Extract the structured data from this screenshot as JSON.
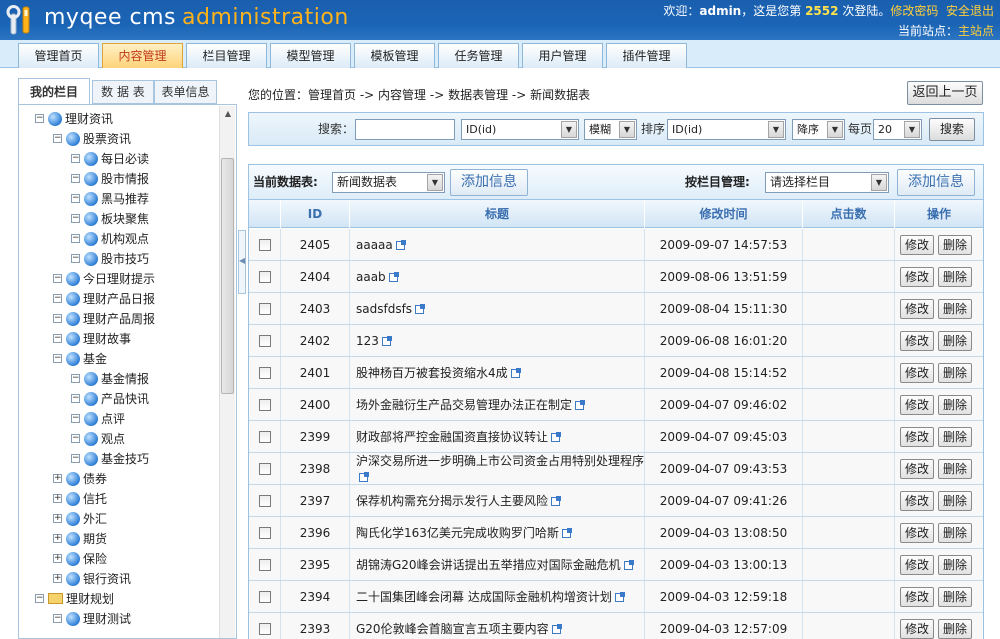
{
  "header": {
    "logo_main": "myqee cms",
    "logo_accent": "administration",
    "welcome_prefix": "欢迎：",
    "username": "admin",
    "welcome_mid": "，这是您第",
    "login_count": "2552",
    "welcome_suffix": "次登陆。",
    "change_password": "修改密码",
    "logout": "安全退出",
    "site_label": "当前站点：",
    "site_name": "主站点"
  },
  "nav": {
    "tabs": [
      {
        "label": "管理首页"
      },
      {
        "label": "内容管理"
      },
      {
        "label": "栏目管理"
      },
      {
        "label": "模型管理"
      },
      {
        "label": "模板管理"
      },
      {
        "label": "任务管理"
      },
      {
        "label": "用户管理"
      },
      {
        "label": "插件管理"
      }
    ],
    "active_color": "#c0391b"
  },
  "sidebar": {
    "tabs": [
      {
        "label": "我的栏目"
      },
      {
        "label": "数 据 表"
      },
      {
        "label": "表单信息"
      }
    ],
    "tree": [
      {
        "label": "理财资讯",
        "toggle": "⊟",
        "icon": "globe-icon"
      },
      {
        "label": "股票资讯",
        "toggle": "⊟",
        "icon": "globe-icon"
      },
      {
        "label": "每日必读",
        "toggle": "⊟",
        "icon": "globe-icon"
      },
      {
        "label": "股市情报",
        "toggle": "⊟",
        "icon": "globe-icon"
      },
      {
        "label": "黑马推荐",
        "toggle": "⊟",
        "icon": "globe-icon"
      },
      {
        "label": "板块聚焦",
        "toggle": "⊟",
        "icon": "globe-icon"
      },
      {
        "label": "机构观点",
        "toggle": "⊟",
        "icon": "globe-icon"
      },
      {
        "label": "股市技巧",
        "toggle": "⊟",
        "icon": "globe-icon"
      },
      {
        "label": "今日理财提示",
        "toggle": "⊟",
        "icon": "globe-icon"
      },
      {
        "label": "理财产品日报",
        "toggle": "⊟",
        "icon": "globe-icon"
      },
      {
        "label": "理财产品周报",
        "toggle": "⊟",
        "icon": "globe-icon"
      },
      {
        "label": "理财故事",
        "toggle": "⊟",
        "icon": "globe-icon"
      },
      {
        "label": "基金",
        "toggle": "⊟",
        "icon": "globe-icon"
      },
      {
        "label": "基金情报",
        "toggle": "⊟",
        "icon": "globe-icon"
      },
      {
        "label": "产品快讯",
        "toggle": "⊟",
        "icon": "globe-icon"
      },
      {
        "label": "点评",
        "toggle": "⊟",
        "icon": "globe-icon"
      },
      {
        "label": "观点",
        "toggle": "⊟",
        "icon": "globe-icon"
      },
      {
        "label": "基金技巧",
        "toggle": "⊟",
        "icon": "globe-icon"
      },
      {
        "label": "债券",
        "toggle": "⊞",
        "icon": "globe-icon"
      },
      {
        "label": "信托",
        "toggle": "⊞",
        "icon": "globe-icon"
      },
      {
        "label": "外汇",
        "toggle": "⊞",
        "icon": "globe-icon"
      },
      {
        "label": "期货",
        "toggle": "⊞",
        "icon": "globe-icon"
      },
      {
        "label": "保险",
        "toggle": "⊞",
        "icon": "globe-icon"
      },
      {
        "label": "银行资讯",
        "toggle": "⊞",
        "icon": "globe-icon"
      },
      {
        "label": "理财规划",
        "toggle": "⊟",
        "icon": "folder-icon"
      },
      {
        "label": "理财测试",
        "toggle": "⊟",
        "icon": "globe-icon"
      }
    ]
  },
  "breadcrumb": {
    "prefix": "您的位置：",
    "items": [
      "管理首页",
      "内容管理",
      "数据表管理",
      "新闻数据表"
    ],
    "separator": " -> "
  },
  "back_button": "返回上一页",
  "search": {
    "label": "搜索：",
    "value": "",
    "field_select": "ID(id)",
    "match_select": "模糊",
    "sort_label": "排序",
    "sort_field_select": "ID(id)",
    "order_select": "降序",
    "per_page_label": "每页",
    "per_page_select": "20",
    "button": "搜索"
  },
  "toolbar": {
    "table_label": "当前数据表:",
    "table_select": "新闻数据表",
    "add_button": "添加信息",
    "column_label": "按栏目管理:",
    "column_select": "请选择栏目",
    "add_button_2": "添加信息"
  },
  "grid": {
    "columns": [
      "",
      "ID",
      "标题",
      "修改时间",
      "点击数",
      "操作"
    ],
    "edit_label": "修改",
    "delete_label": "删除",
    "rows": [
      {
        "id": "2405",
        "title": "aaaaa",
        "time": "2009-09-07 14:57:53"
      },
      {
        "id": "2404",
        "title": "aaab",
        "time": "2009-08-06 13:51:59"
      },
      {
        "id": "2403",
        "title": "sadsfdsfs",
        "time": "2009-08-04 15:11:30"
      },
      {
        "id": "2402",
        "title": "123",
        "time": "2009-06-08 16:01:20"
      },
      {
        "id": "2401",
        "title": "股神杨百万被套投资缩水4成",
        "time": "2009-04-08 15:14:52"
      },
      {
        "id": "2400",
        "title": "场外金融衍生产品交易管理办法正在制定",
        "time": "2009-04-07 09:46:02"
      },
      {
        "id": "2399",
        "title": "财政部将严控金融国资直接协议转让",
        "time": "2009-04-07 09:45:03"
      },
      {
        "id": "2398",
        "title": "沪深交易所进一步明确上市公司资金占用特别处理程序",
        "time": "2009-04-07 09:43:53"
      },
      {
        "id": "2397",
        "title": "保荐机构需充分揭示发行人主要风险",
        "time": "2009-04-07 09:41:26"
      },
      {
        "id": "2396",
        "title": "陶氏化学163亿美元完成收购罗门哈斯",
        "time": "2009-04-03 13:08:50"
      },
      {
        "id": "2395",
        "title": "胡锦涛G20峰会讲话提出五举措应对国际金融危机",
        "time": "2009-04-03 13:00:13"
      },
      {
        "id": "2394",
        "title": "二十国集团峰会闭幕 达成国际金融机构增资计划",
        "time": "2009-04-03 12:59:18"
      },
      {
        "id": "2393",
        "title": "G20伦敦峰会首脑宣言五项主要内容",
        "time": "2009-04-03 12:57:09"
      }
    ]
  }
}
